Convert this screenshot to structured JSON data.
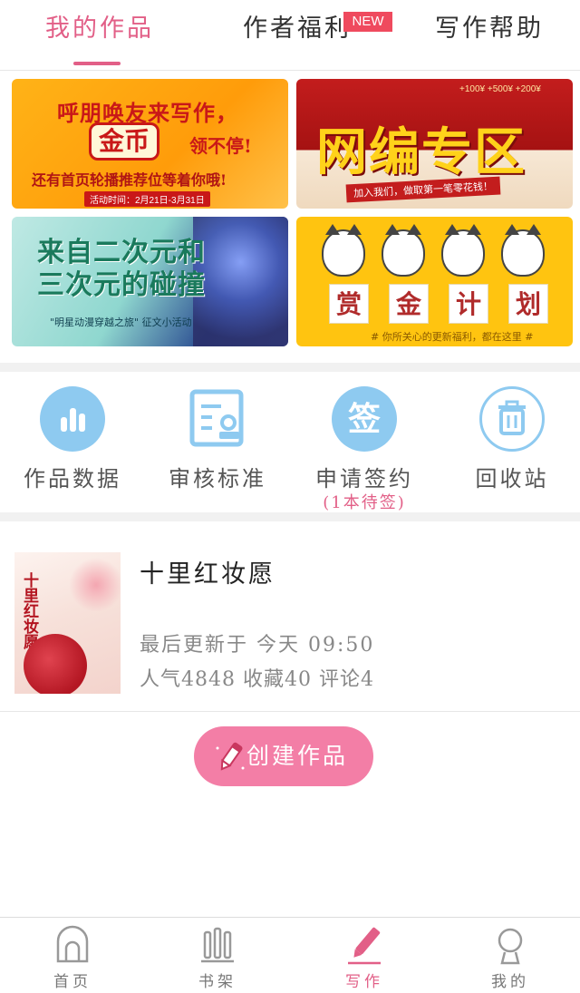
{
  "tabs": [
    {
      "label": "我的作品",
      "active": true
    },
    {
      "label": "作者福利",
      "badge": "NEW"
    },
    {
      "label": "写作帮助"
    }
  ],
  "banners": {
    "b1": {
      "line1": "呼朋唤友来写作，",
      "line2": "金币",
      "line2b": "领不停!",
      "line3": "还有首页轮播推荐位等着你哦!",
      "date": "活动时间：2月21日-3月31日"
    },
    "b2": {
      "title": "网编专区",
      "money": "+100¥ +500¥ +200¥",
      "sub": "加入我们，做取第一笔零花钱！"
    },
    "b3": {
      "title_line1": "来自二次元和",
      "title_line2": "三次元的碰撞",
      "sub": "\"明星动漫穿越之旅\" 征文小活动"
    },
    "b4": {
      "chars": [
        "赏",
        "金",
        "计",
        "划"
      ],
      "sub": "# 你所关心的更新福利，都在这里 #"
    }
  },
  "actions": [
    {
      "label": "作品数据",
      "icon": "bar-chart-icon"
    },
    {
      "label": "审核标准",
      "icon": "review-document-icon"
    },
    {
      "label": "申请签约",
      "icon": "sign-icon",
      "glyph": "签",
      "sub": "(1本待签)"
    },
    {
      "label": "回收站",
      "icon": "trash-icon"
    }
  ],
  "work": {
    "title": "十里红妆愿",
    "cover_title": "十里红妆愿",
    "updated": "最后更新于 今天 09:50",
    "stats": "人气4848 收藏40 评论4"
  },
  "create_button": {
    "label": "创建作品"
  },
  "bottom_nav": [
    {
      "label": "首页",
      "icon": "home-icon"
    },
    {
      "label": "书架",
      "icon": "bookshelf-icon"
    },
    {
      "label": "写作",
      "icon": "pencil-icon",
      "active": true
    },
    {
      "label": "我的",
      "icon": "profile-icon"
    }
  ],
  "colors": {
    "accent": "#e25f87",
    "button": "#f37ea6",
    "icon_blue": "#8ecaf0",
    "badge": "#ef4a5e"
  }
}
